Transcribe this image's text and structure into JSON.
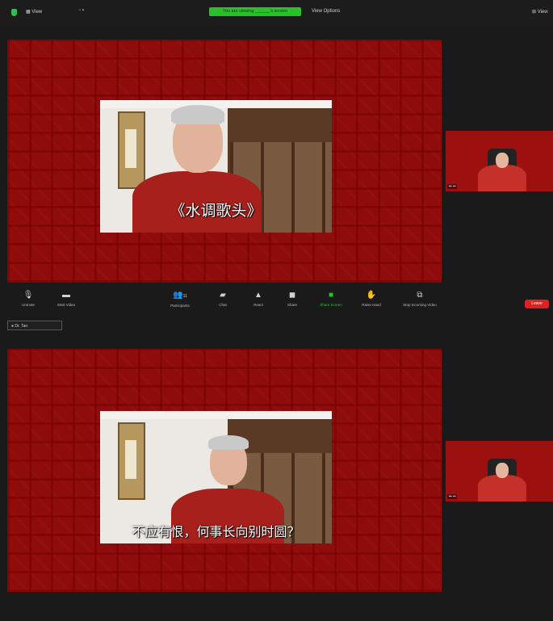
{
  "topbar": {
    "view_label": "View",
    "recording_banner": "You are viewing ______'s screen",
    "view_options": "View Options",
    "view_button": "View"
  },
  "share_top": {
    "subtitle": "《水调歌头》"
  },
  "share_bottom": {
    "subtitle": "不应有恨，何事长向别时圆？"
  },
  "thumb_name": "",
  "toolbar": {
    "items": [
      {
        "label": "Unmute",
        "icon": "microphone-icon"
      },
      {
        "label": "Start Video",
        "icon": "video-camera-icon"
      },
      {
        "label": "Participants",
        "icon": "participants-icon",
        "count": "11"
      },
      {
        "label": "Chat",
        "icon": "chat-icon"
      },
      {
        "label": "React",
        "icon": "react-icon"
      },
      {
        "label": "Share",
        "icon": "share-icon"
      },
      {
        "label": "Share Screen",
        "icon": "share-screen-icon"
      },
      {
        "label": "Raise Hand",
        "icon": "raise-hand-icon"
      },
      {
        "label": "Stop Incoming Video",
        "icon": "stop-video-icon"
      }
    ],
    "end_label": "Leave"
  },
  "name_tag": "Dr. Tan"
}
